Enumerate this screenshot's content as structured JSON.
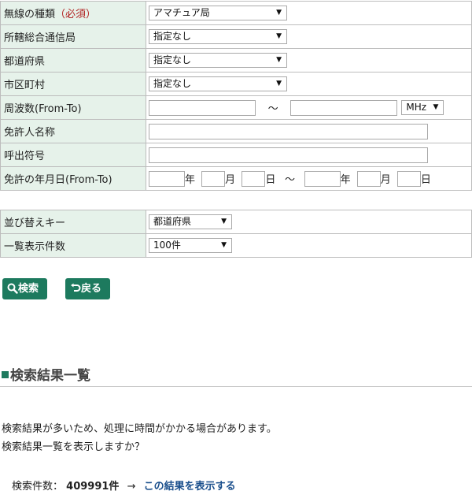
{
  "form1": {
    "rows": [
      {
        "label": "無線の種類",
        "required": "（必須）",
        "select": "アマチュア局"
      },
      {
        "label": "所轄総合通信局",
        "select": "指定なし"
      },
      {
        "label": "都道府県",
        "select": "指定なし"
      },
      {
        "label": "市区町村",
        "select": "指定なし"
      },
      {
        "label": "周波数(From-To)",
        "tilde": "～",
        "unit_select": "MHz"
      },
      {
        "label": "免許人名称"
      },
      {
        "label": "呼出符号"
      },
      {
        "label": "免許の年月日(From-To)",
        "year": "年",
        "month": "月",
        "day": "日",
        "tilde": "～"
      }
    ]
  },
  "form2": {
    "rows": [
      {
        "label": "並び替えキー",
        "select": "都道府県"
      },
      {
        "label": "一覧表示件数",
        "select": "100件"
      }
    ]
  },
  "buttons": {
    "search": "検索",
    "back": "戻る"
  },
  "icons": {
    "search": "magnifier-icon",
    "back": "return-arrow-icon",
    "heading": "square-icon"
  },
  "colors": {
    "accent": "#1d7a5e",
    "label_bg": "#e6f2ea",
    "required": "#b22222",
    "link": "#1a4f8c"
  },
  "results": {
    "heading": "検索結果一覧",
    "message1": "検索結果が多いため、処理に時間がかかる場合があります。",
    "message2": "検索結果一覧を表示しますか？",
    "count_label": "検索件数：",
    "count_value": "409991件",
    "arrow": "→",
    "link": "この結果を表示する"
  }
}
